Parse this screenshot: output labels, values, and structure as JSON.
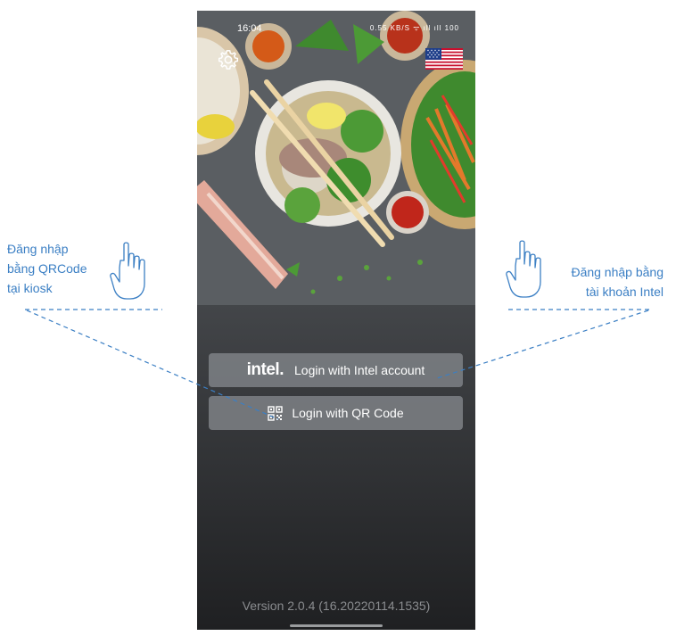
{
  "status_bar": {
    "time": "16:04",
    "icons_text": "0.55 KB/S  ᯤ  ıll  ıll  100"
  },
  "settings": {
    "icon": "gear-icon"
  },
  "language": {
    "icon": "us-flag-icon"
  },
  "buttons": {
    "intel_logo": "intel.",
    "intel_label": "Login with Intel account",
    "qr_label": "Login with QR Code"
  },
  "version": "Version 2.0.4 (16.20220114.1535)",
  "annotations": {
    "left": [
      "Đăng nhập",
      "bằng QRCode",
      "tại kiosk"
    ],
    "right": [
      "Đăng nhập bằng",
      "tài khoản Intel"
    ]
  },
  "colors": {
    "annotation": "#3b7fc4",
    "button_bg": "#7a7e82"
  }
}
